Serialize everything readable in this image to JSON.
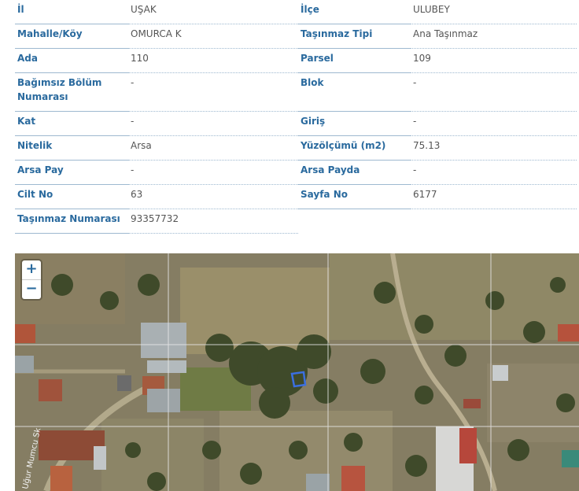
{
  "parcel_info": {
    "left": [
      {
        "label": "İl",
        "value": "UŞAK"
      },
      {
        "label": "Mahalle/Köy",
        "value": "OMURCA K"
      },
      {
        "label": "Ada",
        "value": "110"
      },
      {
        "label": "Bağımsız Bölüm Numarası",
        "value": "-"
      },
      {
        "label": "Kat",
        "value": "-"
      },
      {
        "label": "Nitelik",
        "value": "Arsa"
      },
      {
        "label": "Arsa Pay",
        "value": "-"
      },
      {
        "label": "Cilt No",
        "value": "63"
      },
      {
        "label": "Taşınmaz Numarası",
        "value": "93357732"
      }
    ],
    "right": [
      {
        "label": "İlçe",
        "value": "ULUBEY"
      },
      {
        "label": "Taşınmaz Tipi",
        "value": "Ana Taşınmaz"
      },
      {
        "label": "Parsel",
        "value": "109"
      },
      {
        "label": "Blok",
        "value": "-"
      },
      {
        "label": "Giriş",
        "value": "-"
      },
      {
        "label": "Yüzölçümü (m2)",
        "value": "75.13"
      },
      {
        "label": "Arsa Payda",
        "value": "-"
      },
      {
        "label": "Sayfa No",
        "value": "6177"
      }
    ]
  },
  "map": {
    "zoom_in_label": "+",
    "zoom_out_label": "−",
    "street_label": "Uğur Mumcu Sk",
    "parcel_color": "#3b6fe0",
    "grid_color": "#e8e8e8"
  }
}
